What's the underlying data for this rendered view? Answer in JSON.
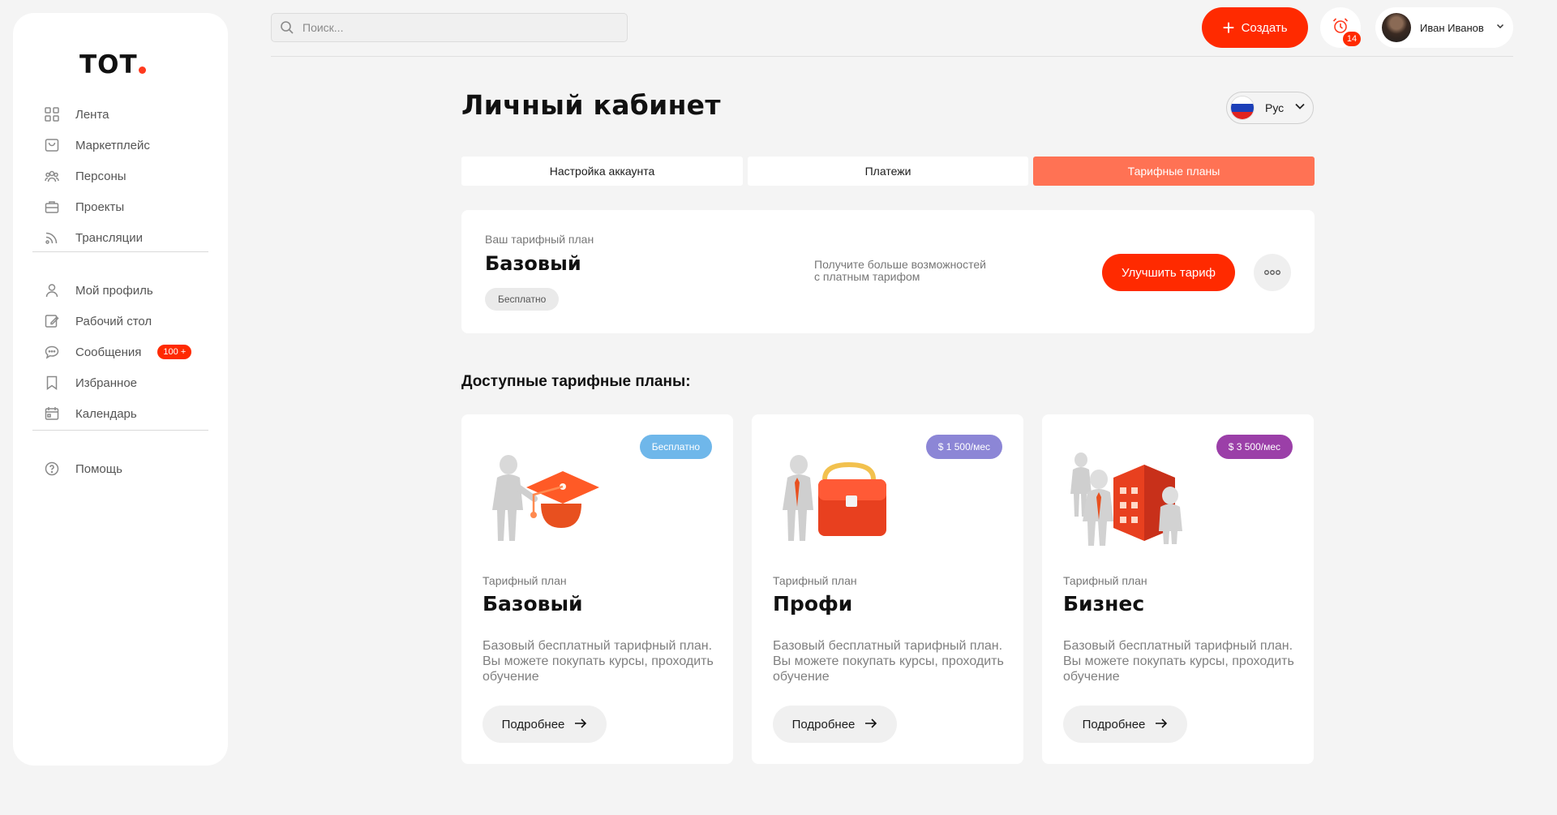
{
  "app": {
    "logo": "TOT"
  },
  "sidebar": {
    "items": [
      {
        "label": "Лента",
        "icon": "grid-icon"
      },
      {
        "label": "Маркетплейс",
        "icon": "shopping-bag-icon"
      },
      {
        "label": "Персоны",
        "icon": "people-icon"
      },
      {
        "label": "Проекты",
        "icon": "briefcase-icon"
      },
      {
        "label": "Трансляции",
        "icon": "broadcast-icon"
      },
      {
        "label": "Мой профиль",
        "icon": "user-icon"
      },
      {
        "label": "Рабочий стол",
        "icon": "edit-icon"
      },
      {
        "label": "Сообщения",
        "icon": "chat-icon",
        "badge": "100 +"
      },
      {
        "label": "Избранное",
        "icon": "bookmark-icon"
      },
      {
        "label": "Календарь",
        "icon": "calendar-icon"
      },
      {
        "label": "Помощь",
        "icon": "help-icon"
      }
    ]
  },
  "header": {
    "search_placeholder": "Поиск...",
    "create_label": "Создать",
    "notifications_count": "14",
    "user_name": "Иван Иванов"
  },
  "main": {
    "title": "Личный кабинет",
    "language": "Рус",
    "tabs": [
      {
        "label": "Настройка аккаунта",
        "active": false
      },
      {
        "label": "Платежи",
        "active": false
      },
      {
        "label": "Тарифные планы",
        "active": true
      }
    ],
    "current_plan": {
      "label": "Ваш тарифный план",
      "name": "Базовый",
      "badge": "Бесплатно",
      "promo_line1": "Получите больше возможностей",
      "promo_line2": "с платным тарифом",
      "upgrade_label": "Улучшить тариф"
    },
    "available_title": "Доступные тарифные планы:",
    "plans": [
      {
        "badge": "Бесплатно",
        "badge_color": "#6fb7ea",
        "label": "Тарифный план",
        "name": "Базовый",
        "description": "Базовый бесплатный тарифный план. Вы можете покупать курсы, проходить обучение",
        "button": "Подробнее",
        "icon": "graduation-cap-illustration"
      },
      {
        "badge": "$ 1 500/мес",
        "badge_color": "#8c86d6",
        "label": "Тарифный план",
        "name": "Профи",
        "description": "Базовый бесплатный тарифный план. Вы можете покупать курсы, проходить обучение",
        "button": "Подробнее",
        "icon": "briefcase-illustration"
      },
      {
        "badge": "$ 3 500/мес",
        "badge_color": "#9b3fa8",
        "label": "Тарифный план",
        "name": "Бизнес",
        "description": "Базовый бесплатный тарифный план. Вы можете покупать курсы, проходить обучение",
        "button": "Подробнее",
        "icon": "office-building-illustration"
      }
    ]
  },
  "colors": {
    "accent": "#ff2a00",
    "tab_active": "#ff7254",
    "background": "#f4f4f4"
  }
}
